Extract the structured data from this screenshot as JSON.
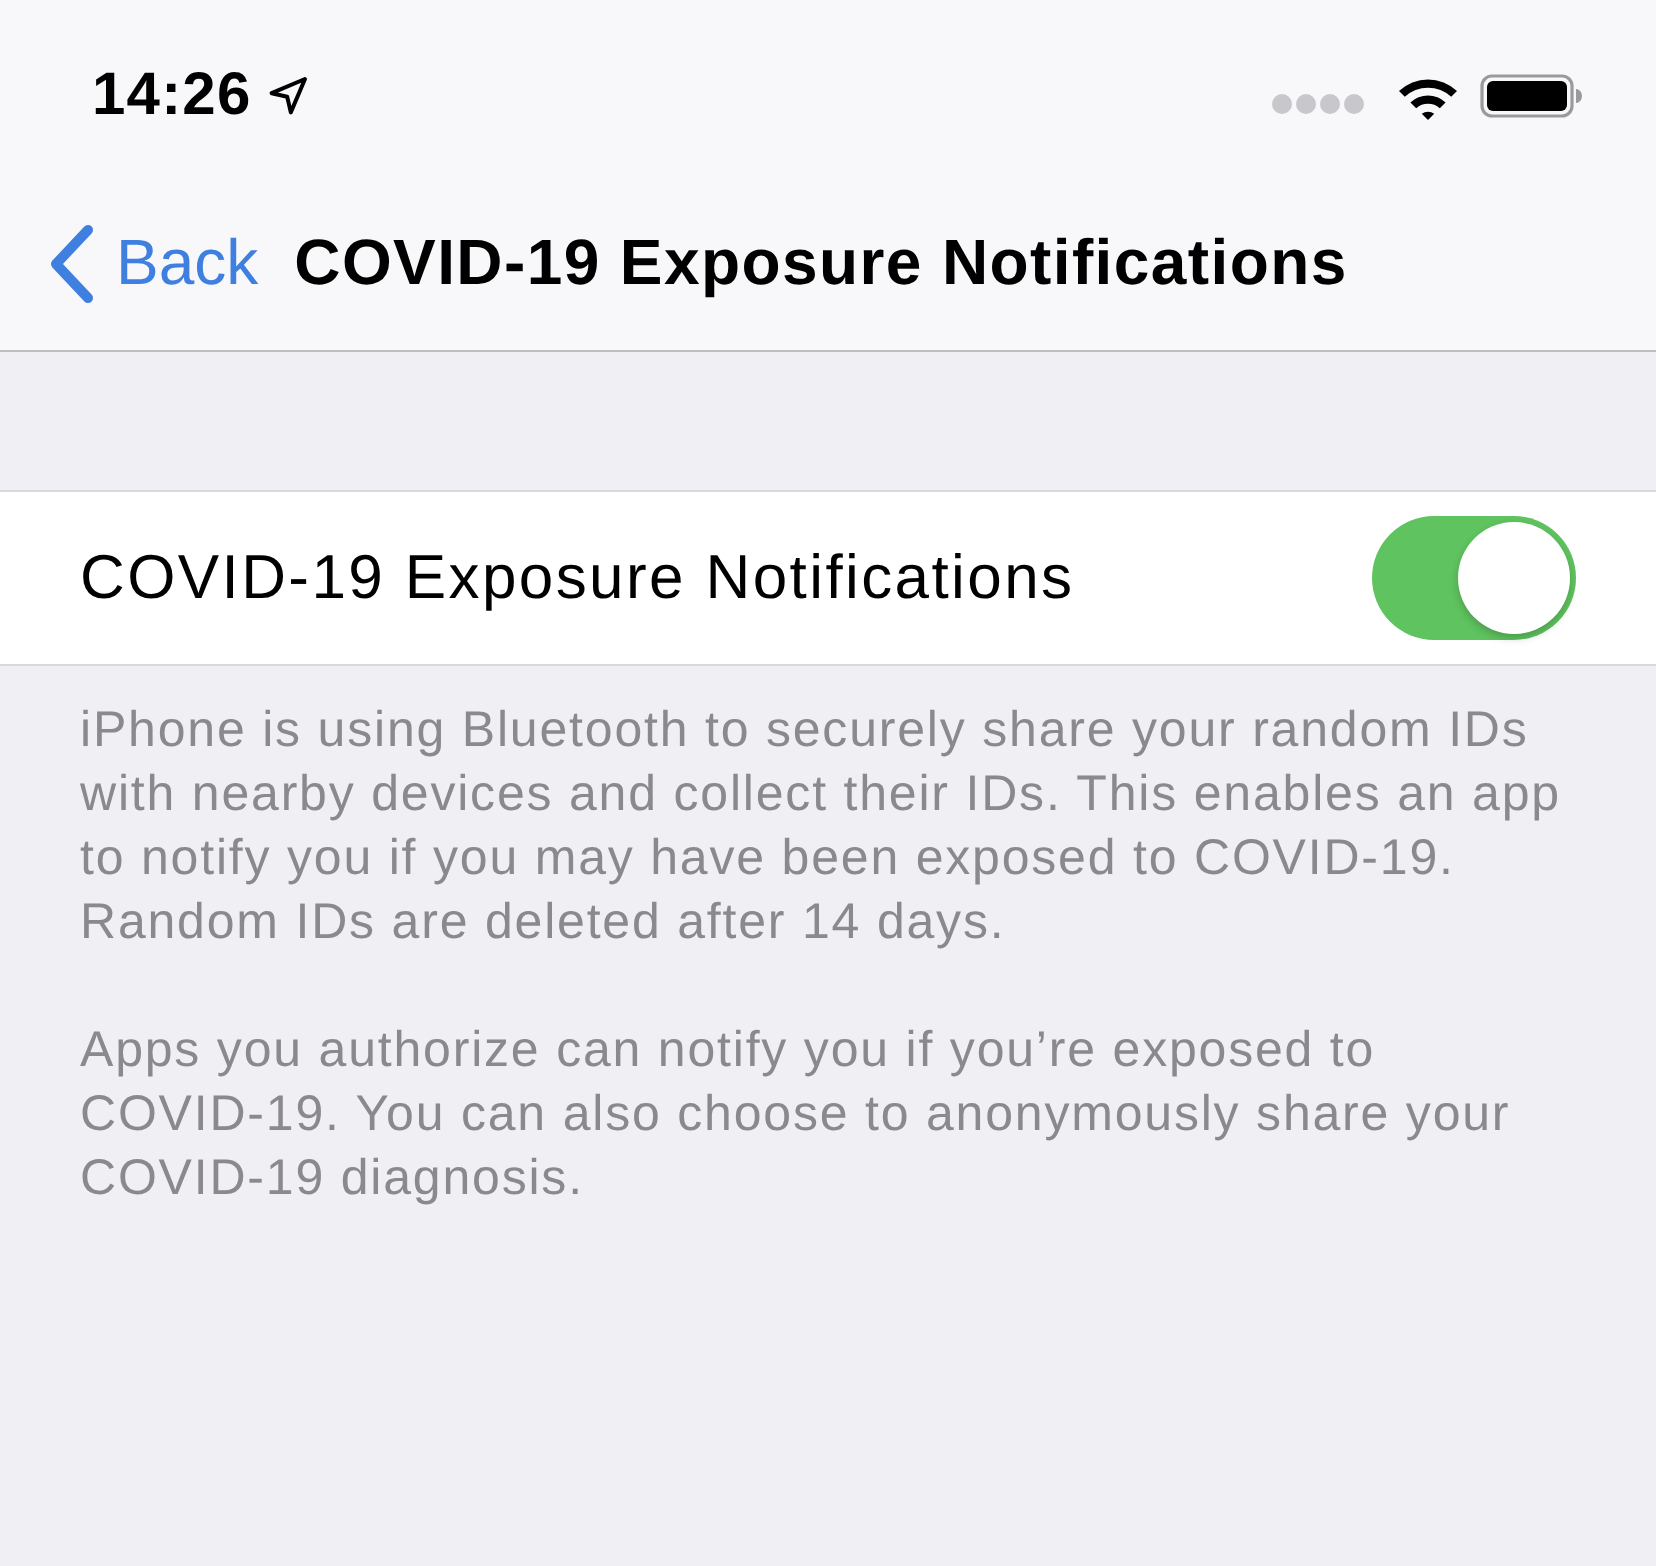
{
  "status_bar": {
    "time": "14:26"
  },
  "nav_bar": {
    "back_label": "Back",
    "title": "COVID-19 Exposure Notifications"
  },
  "settings": [
    {
      "kind": "toggle",
      "label": "COVID-19 Exposure Notifications",
      "on": true
    }
  ],
  "footer": [
    "iPhone is using Bluetooth to securely share your random IDs with nearby devices and collect their IDs. This enables an app to notify you if you may have been exposed to COVID-19. Random IDs are deleted after 14 days.",
    "Apps you authorize can notify you if you’re exposed to COVID-19. You can also choose to anonymously share your COVID-19 diagnosis."
  ]
}
